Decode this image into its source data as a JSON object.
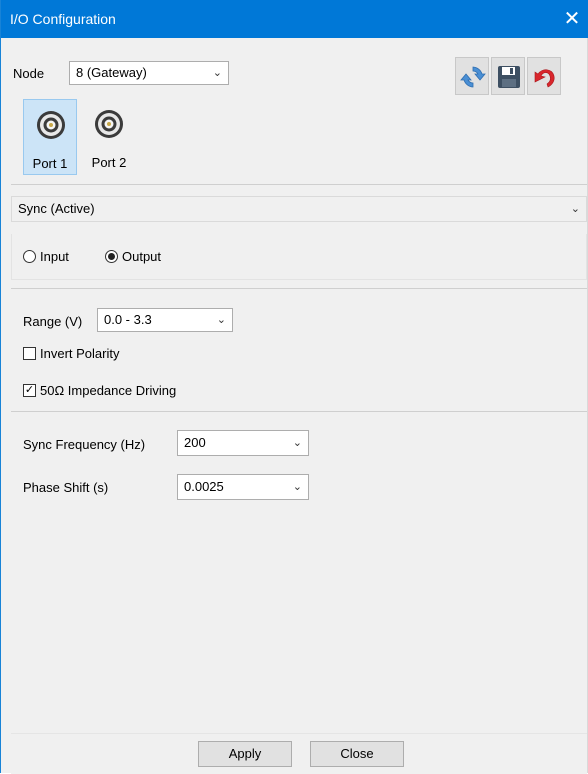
{
  "window": {
    "title": "I/O Configuration",
    "close_glyph": "✕"
  },
  "node": {
    "label": "Node",
    "value": "8 (Gateway)"
  },
  "toolbar": {
    "icons": [
      "refresh-icon",
      "save-icon",
      "undo-icon"
    ]
  },
  "ports": [
    {
      "label": "Port 1",
      "selected": true
    },
    {
      "label": "Port 2",
      "selected": false
    }
  ],
  "sync_mode": {
    "value": "Sync (Active)"
  },
  "direction": {
    "input_label": "Input",
    "output_label": "Output",
    "selected": "Output"
  },
  "range": {
    "label": "Range (V)",
    "value": "0.0 - 3.3"
  },
  "invert_polarity": {
    "label": "Invert Polarity",
    "checked": false
  },
  "impedance": {
    "label": "50Ω Impedance Driving",
    "checked": true
  },
  "sync_frequency": {
    "label": "Sync Frequency (Hz)",
    "value": "200"
  },
  "phase_shift": {
    "label": "Phase Shift (s)",
    "value": "0.0025"
  },
  "footer": {
    "apply_label": "Apply",
    "close_label": "Close"
  },
  "colors": {
    "titlebar": "#0078d7",
    "selected_port": "#cce4f7",
    "refresh_icon": "#4a8fd4",
    "save_icon": "#3d4f62",
    "undo_icon": "#d9262c"
  }
}
